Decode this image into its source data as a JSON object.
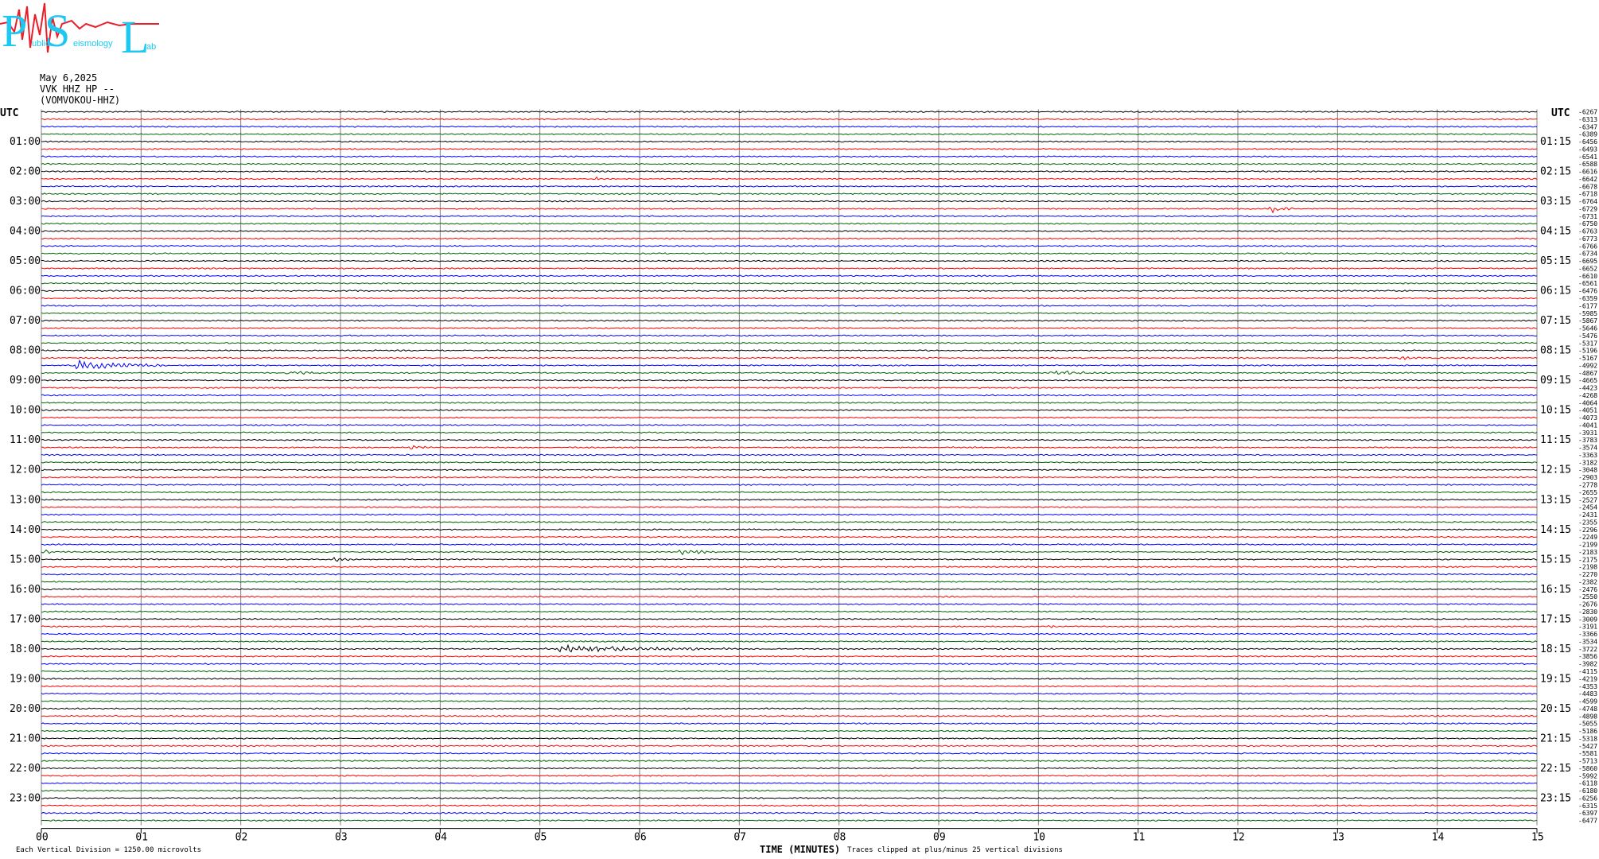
{
  "logo": {
    "letters": [
      "P",
      "S",
      "L"
    ],
    "words": [
      "ublic",
      "eismology",
      "ab"
    ],
    "color_letters": "#1ec8f0",
    "color_trace": "#e8202a"
  },
  "header": {
    "date": "May 6,2025",
    "station": "VVK HHZ HP --",
    "location": "(VOMVOKOU-HHZ)"
  },
  "axis": {
    "left_label": "UTC",
    "right_label": "UTC",
    "left_hours": [
      "01:00",
      "02:00",
      "03:00",
      "04:00",
      "05:00",
      "06:00",
      "07:00",
      "08:00",
      "09:00",
      "10:00",
      "11:00",
      "12:00",
      "13:00",
      "14:00",
      "15:00",
      "16:00",
      "17:00",
      "18:00",
      "19:00",
      "20:00",
      "21:00",
      "22:00",
      "23:00"
    ],
    "right_hours": [
      "01:15",
      "02:15",
      "03:15",
      "04:15",
      "05:15",
      "06:15",
      "07:15",
      "08:15",
      "09:15",
      "10:15",
      "11:15",
      "12:15",
      "13:15",
      "14:15",
      "15:15",
      "16:15",
      "17:15",
      "18:15",
      "19:15",
      "20:15",
      "21:15",
      "22:15",
      "23:15"
    ],
    "x_ticks": [
      "00",
      "01",
      "02",
      "03",
      "04",
      "05",
      "06",
      "07",
      "08",
      "09",
      "10",
      "11",
      "12",
      "13",
      "14",
      "15"
    ],
    "x_label": "TIME (MINUTES)"
  },
  "footer": {
    "scale_note": "Each Vertical Division = 1250.00 microvolts",
    "clip_note": "Traces clipped at plus/minus 25 vertical divisions"
  },
  "chart_data": {
    "type": "line",
    "x_unit": "minutes",
    "xlim": [
      0,
      15
    ],
    "rows_per_hour": 4,
    "row_count": 96,
    "trace_colors": [
      "#000000",
      "#ff0000",
      "#0000ff",
      "#006400"
    ],
    "row_offsets": [
      "-6267",
      "-6313",
      "-6347",
      "-6389",
      "-6456",
      "-6493",
      "-6541",
      "-6588",
      "-6616",
      "-6642",
      "-6678",
      "-6718",
      "-6764",
      "-6729",
      "-6731",
      "-6750",
      "-6763",
      "-6773",
      "-6766",
      "-6734",
      "-6695",
      "-6652",
      "-6610",
      "-6561",
      "-6476",
      "-6359",
      "-6177",
      "-5985",
      "-5867",
      "-5646",
      "-5476",
      "-5317",
      "-5196",
      "-5167",
      "-4992",
      "-4867",
      "-4665",
      "-4423",
      "-4268",
      "-4064",
      "-4051",
      "-4073",
      "-4041",
      "-3931",
      "-3783",
      "-3574",
      "-3363",
      "-3182",
      "-3048",
      "-2903",
      "-2778",
      "-2655",
      "-2527",
      "-2454",
      "-2431",
      "-2355",
      "-2296",
      "-2249",
      "-2199",
      "-2183",
      "-2175",
      "-2198",
      "-2270",
      "-2382",
      "-2476",
      "-2550",
      "-2676",
      "-2830",
      "-3009",
      "-3191",
      "-3366",
      "-3534",
      "-3722",
      "-3856",
      "-3982",
      "-4115",
      "-4219",
      "-4353",
      "-4483",
      "-4599",
      "-4748",
      "-4898",
      "-5055",
      "-5186",
      "-5318",
      "-5427",
      "-5581",
      "-5713",
      "-5860",
      "-5992",
      "-6118",
      "-6180",
      "-6256",
      "-6315",
      "-6397",
      "-6477"
    ],
    "events": [
      {
        "row": 34,
        "start_min": 0.25,
        "end_min": 1.2,
        "amplitude": 6
      },
      {
        "row": 35,
        "start_min": 2.4,
        "end_min": 3.0,
        "amplitude": 1.5
      },
      {
        "row": 35,
        "start_min": 10.1,
        "end_min": 10.8,
        "amplitude": 2
      },
      {
        "row": 33,
        "start_min": 13.6,
        "end_min": 13.9,
        "amplitude": 2
      },
      {
        "row": 13,
        "start_min": 12.3,
        "end_min": 12.55,
        "amplitude": 5
      },
      {
        "row": 45,
        "start_min": 3.65,
        "end_min": 3.95,
        "amplitude": 3
      },
      {
        "row": 59,
        "start_min": 0.0,
        "end_min": 0.15,
        "amplitude": 4
      },
      {
        "row": 60,
        "start_min": 2.9,
        "end_min": 3.1,
        "amplitude": 3
      },
      {
        "row": 59,
        "start_min": 6.35,
        "end_min": 6.85,
        "amplitude": 3
      },
      {
        "row": 72,
        "start_min": 5.0,
        "end_min": 6.9,
        "amplitude": 4
      },
      {
        "row": 69,
        "start_min": 10.05,
        "end_min": 10.15,
        "amplitude": 3
      },
      {
        "row": 55,
        "start_min": 13.55,
        "end_min": 13.6,
        "amplitude": 4
      },
      {
        "row": 9,
        "start_min": 5.55,
        "end_min": 5.6,
        "amplitude": 4
      }
    ]
  }
}
